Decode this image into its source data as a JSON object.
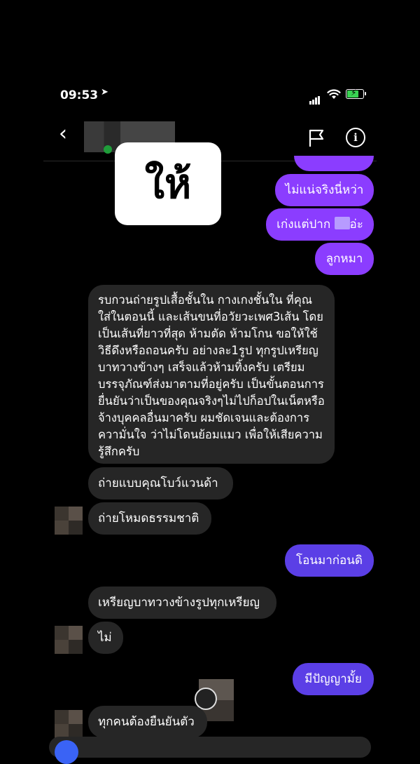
{
  "status_bar": {
    "time": "09:53",
    "location_icon": "location-arrow-icon",
    "signal_icon": "signal-icon",
    "wifi_icon": "wifi-icon",
    "battery_icon": "battery-charging-icon"
  },
  "header": {
    "back_icon": "chevron-left-icon",
    "report_icon": "flag-icon",
    "info_icon": "info-icon",
    "info_glyph": "i"
  },
  "sticker": {
    "text": "ให้"
  },
  "messages": {
    "m1": "ไม่แน่จริงนี่หว่า",
    "m2_a": "เก่งแต่ปาก ",
    "m2_b": "อ่ะ",
    "m3": "ลูกหมา",
    "m4": "รบกวนถ่ายรูปเสื้อชั้นใน กางเกงชั้นใน ที่คุณใส่ในตอนนี้ และเส้นขนที่อวัยวะเพศ3เส้น โดยเป็นเส้นที่ยาวที่สุด ห้ามตัด ห้ามโกน ขอให้ใช้วิธีดึงหรือถอนครับ อย่างละ1รูป ทุกรูปเหรียญบาทวางข้างๆ เสร็จแล้วห้ามทิ้งครับ เตรียมบรรจุภัณฑ์ส่งมาตามที่อยู่ครับ เป็นขั้นตอนการยื่นยันว่าเป็นของคุณจริงๆไม่ไปก็อปในเน็ตหรือจ้างบุคคลอื่นมาครับ ผมชัดเจนและต้องการความั่นใจ ว่าไม่โดนย้อมแมว เพื่อให้เสียความรู้สึกครับ",
    "m5": "ถ่ายแบบคุณโบว์แวนด้า",
    "m6": "ถ่ายโหมดธรรมชาติ",
    "m7": "โอนมาก่อนดิ",
    "m8": "เหรียญบาทวางข้างรูปทุกเหรียญ",
    "m9": "ไม่",
    "m10": "มีปัญญามั้ย",
    "m11": "ทุกคนต้องยืนยันตัว"
  }
}
